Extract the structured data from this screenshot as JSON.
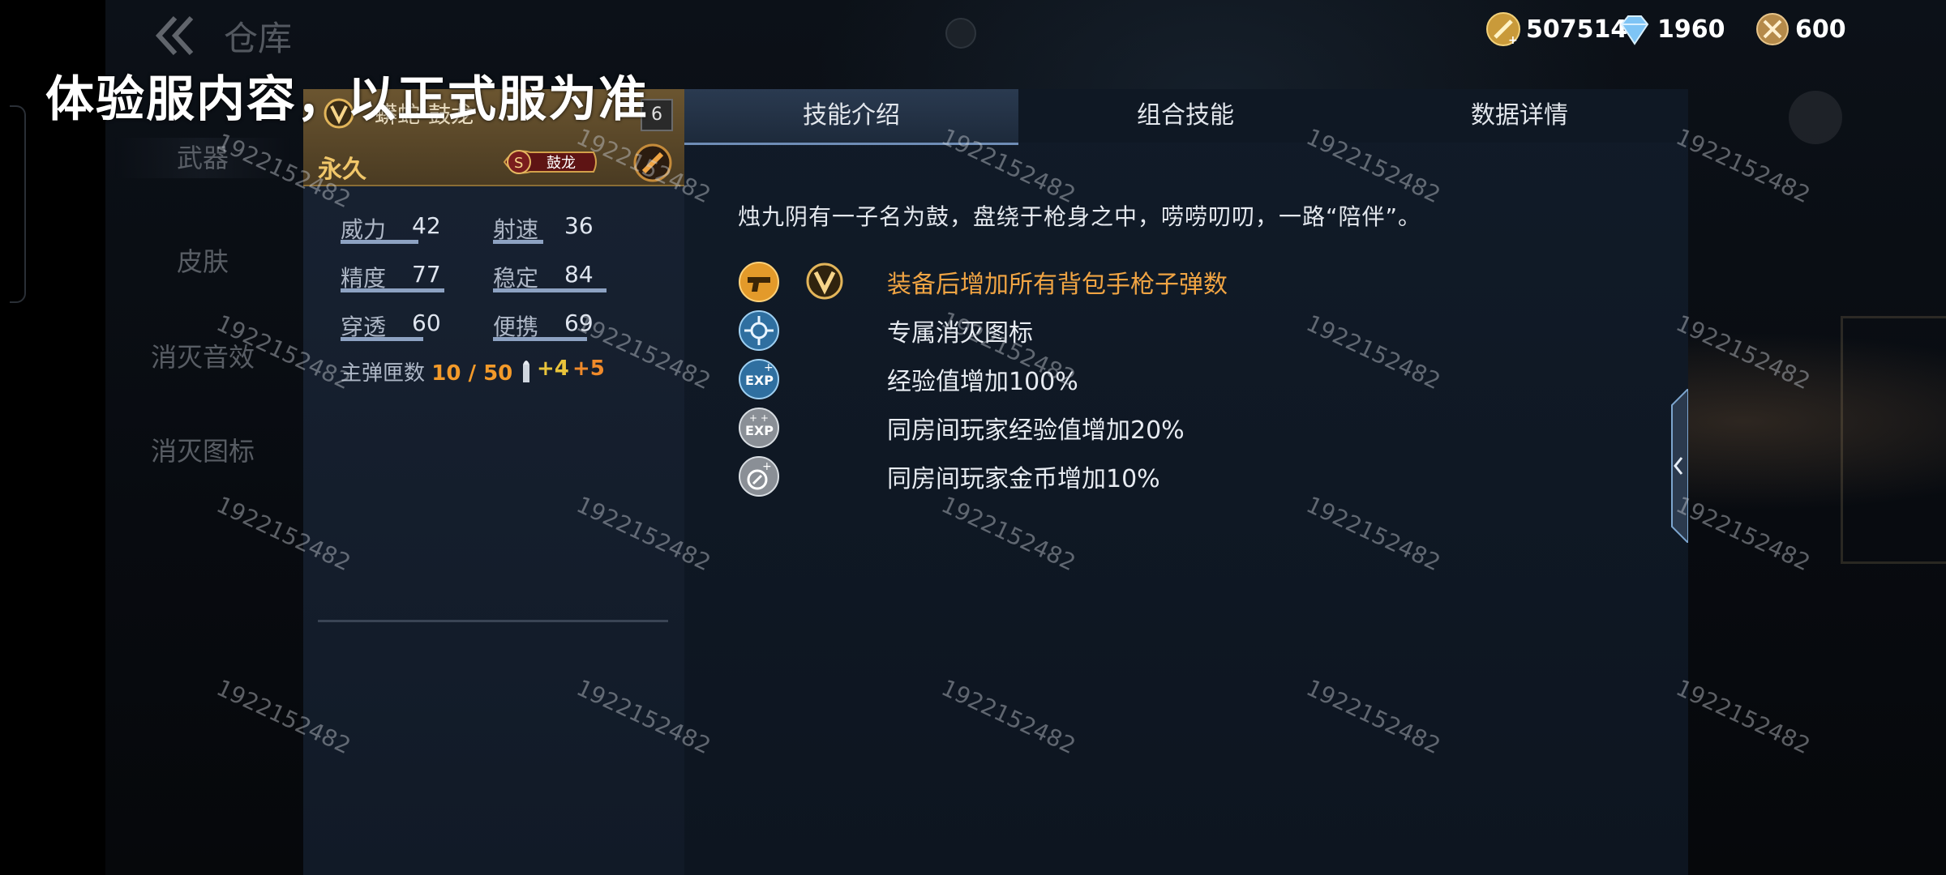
{
  "header": {
    "title": "仓库",
    "currencies": [
      {
        "icon": "gold-coin-icon",
        "value": "507514"
      },
      {
        "icon": "diamond-icon",
        "value": "1960"
      },
      {
        "icon": "crossed-swords-coin-icon",
        "value": "600"
      }
    ]
  },
  "notice": "体验服内容，以正式服为准",
  "categories": [
    {
      "label": "武器"
    },
    {
      "label": "皮肤"
    },
    {
      "label": "消灭音效"
    },
    {
      "label": "消灭图标"
    }
  ],
  "weapon": {
    "name": "蟒蛇-鼓龙",
    "level": "6",
    "duration": "永久",
    "skin_badge": "鼓龙",
    "stats": [
      {
        "label": "威力",
        "value": "42"
      },
      {
        "label": "射速",
        "value": "36"
      },
      {
        "label": "精度",
        "value": "77"
      },
      {
        "label": "稳定",
        "value": "84"
      },
      {
        "label": "穿透",
        "value": "60"
      },
      {
        "label": "便携",
        "value": "69"
      }
    ],
    "ammo_label": "主弹匣数",
    "ammo_value": "10 / 50",
    "ammo_bonus_1": "+4",
    "ammo_bonus_2": "+5"
  },
  "tabs": [
    {
      "label": "技能介绍"
    },
    {
      "label": "组合技能"
    },
    {
      "label": "数据详情"
    }
  ],
  "description": "烛九阴有一子名为鼓，盘绕于枪身之中，唠唠叨叨，一路“陪伴”。",
  "skills": [
    {
      "icon": "pistol-icon",
      "text": "装备后增加所有背包手枪子弹数"
    },
    {
      "icon": "kill-icon-emblem",
      "text": "专属消灭图标"
    },
    {
      "icon": "exp-plus-icon",
      "text": "经验值增加100%"
    },
    {
      "icon": "room-exp-icon",
      "text": "同房间玩家经验值增加20%"
    },
    {
      "icon": "room-coin-icon",
      "text": "同房间玩家金币增加10%"
    }
  ],
  "watermark": "1922152482",
  "colors": {
    "accent_gold": "#f0a443",
    "ammo_orange": "#f39a2a",
    "header_bronze": "#6b5530"
  }
}
